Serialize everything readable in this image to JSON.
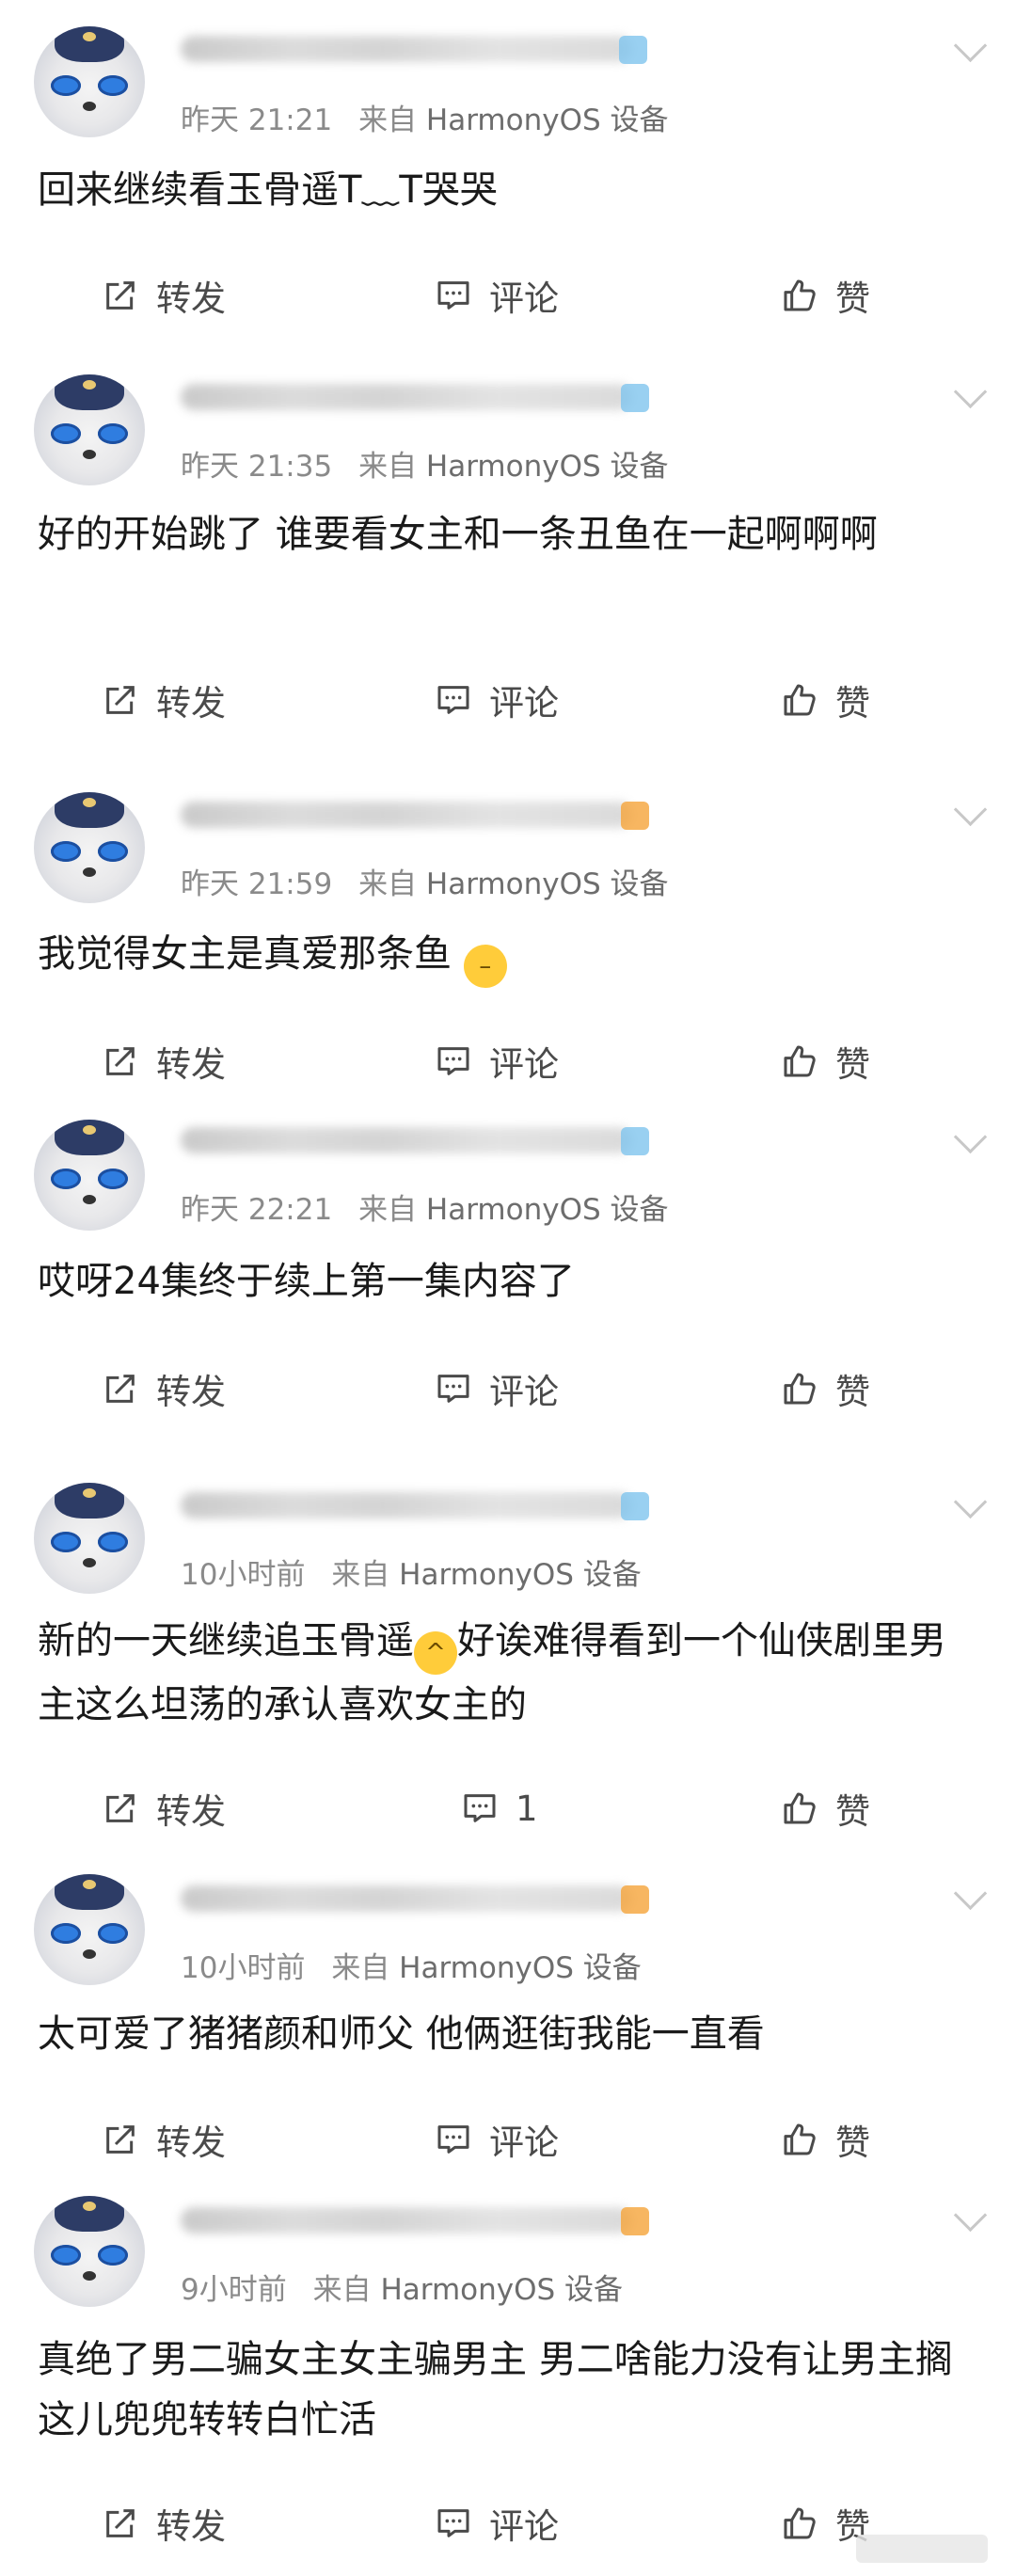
{
  "device_label": "HarmonyOS 设备",
  "source_prefix": "来自",
  "actions": {
    "repost": "转发",
    "comment": "评论",
    "like": "赞"
  },
  "posts": [
    {
      "time": "昨天 21:21",
      "content": "回来继续看玉骨遥T﹏T哭哭",
      "comments": "评论"
    },
    {
      "time": "昨天 21:35",
      "content": "好的开始跳了 谁要看女主和一条丑鱼在一起啊啊啊",
      "comments": "评论"
    },
    {
      "time": "昨天 21:59",
      "content": "我觉得女主是真爱那条鱼",
      "comments": "评论"
    },
    {
      "time": "昨天 22:21",
      "content": "哎呀24集终于续上第一集内容了",
      "comments": "评论"
    },
    {
      "time": "10小时前",
      "content_a": "新的一天继续追玉骨遥",
      "content_b": "好诶难得看到一个仙侠剧里男主这么坦荡的承认喜欢女主的",
      "comments": "1"
    },
    {
      "time": "10小时前",
      "content": "太可爱了猪猪颜和师父 他俩逛街我能一直看",
      "comments": "评论"
    },
    {
      "time": "9小时前",
      "content": "真绝了男二骗女主女主骗男主 男二啥能力没有让男主搁这儿兜兜转转白忙活",
      "comments": "评论"
    }
  ],
  "colors": {
    "text": "#1a1a1a",
    "meta": "#8a8a8a",
    "action": "#4a4a4a",
    "vip_blue": "#7fc4ee",
    "vip_orange": "#f5a43a"
  }
}
